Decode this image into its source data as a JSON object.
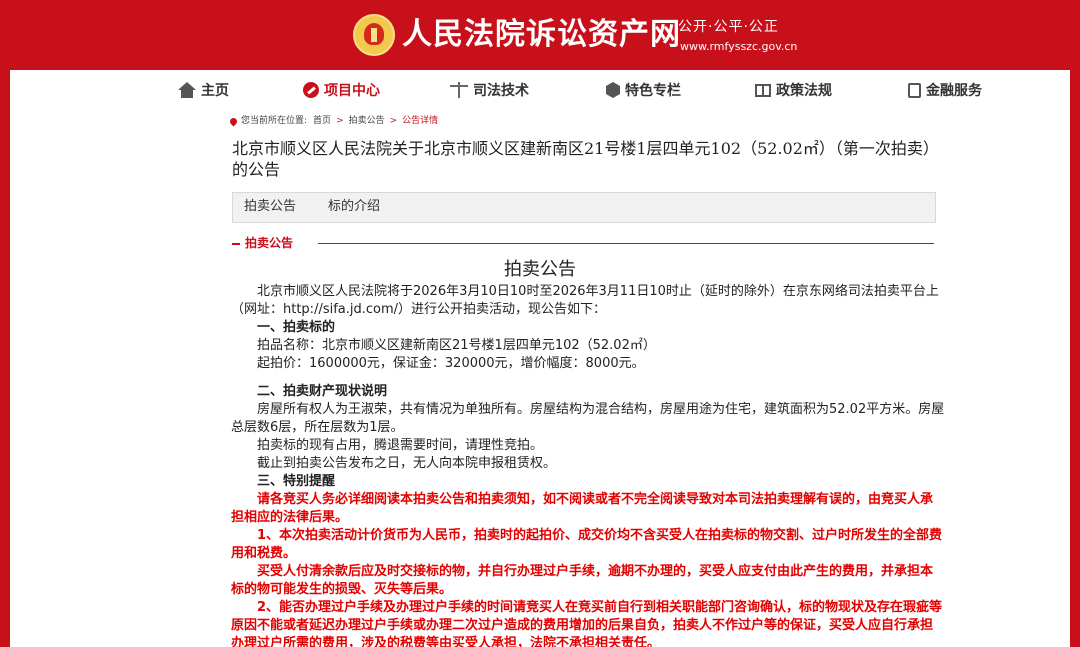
{
  "header": {
    "site_title": "人民法院诉讼资产网",
    "slogan": "公开·公平·公正",
    "url": "www.rmfyssz c.gov.cn",
    "brand_color": "#c8101b"
  },
  "nav": {
    "items": [
      {
        "label": "主页",
        "icon": "home-icon"
      },
      {
        "label": "项目中心",
        "icon": "gavel-icon",
        "active": true
      },
      {
        "label": "司法技术",
        "icon": "scale-icon"
      },
      {
        "label": "特色专栏",
        "icon": "feature-icon"
      },
      {
        "label": "政策法规",
        "icon": "book-icon"
      },
      {
        "label": "金融服务",
        "icon": "finance-icon"
      }
    ]
  },
  "breadcrumb": {
    "prefix": "您当前所在位置:",
    "items": [
      "首页",
      "拍卖公告",
      "公告详情"
    ],
    "sep": ">"
  },
  "page_title": "北京市顺义区人民法院关于北京市顺义区建新南区21号楼1层四单元102（52.02㎡）（第一次拍卖）的公告",
  "tabs": [
    "拍卖公告",
    "标的介绍"
  ],
  "section_label": "拍卖公告",
  "notice": {
    "title": "拍卖公告",
    "intro": "北京市顺义区人民法院将于2026年3月10日10时至2026年3月11日10时止（延时的除外）在京东网络司法拍卖平台上（网址：http://sifa.jd.com/）进行公开拍卖活动，现公告如下：",
    "h1": "一、拍卖标的",
    "item_name": "拍品名称：北京市顺义区建新南区21号楼1层四单元102（52.02㎡）",
    "prices": "起拍价：1600000元，保证金：320000元，增价幅度：8000元。",
    "h2": "二、拍卖财产现状说明",
    "status1": "房屋所有权人为王淑荣，共有情况为单独所有。房屋结构为混合结构，房屋用途为住宅，建筑面积为52.02平方米。房屋总层数6层，所在层数为1层。",
    "status2": "拍卖标的现有占用，腾退需要时间，请理性竞拍。",
    "status3": "截止到拍卖公告发布之日，无人向本院申报租赁权。",
    "h3": "三、特别提醒",
    "red1": "请各竞买人务必详细阅读本拍卖公告和拍卖须知，如不阅读或者不完全阅读导致对本司法拍卖理解有误的，由竞买人承担相应的法律后果。",
    "red2": "1、本次拍卖活动计价货币为人民币，拍卖时的起拍价、成交价均不含买受人在拍卖标的物交割、过户时所发生的全部费用和税费。",
    "red3": "买受人付清余款后应及时交接标的物，并自行办理过户手续，逾期不办理的，买受人应支付由此产生的费用，并承担本标的物可能发生的损毁、灭失等后果。",
    "red4": "2、能否办理过户手续及办理过户手续的时间请竞买人在竞买前自行到相关职能部门咨询确认，标的物现状及存在瑕疵等原因不能或者延迟办理过户手续或办理二次过户造成的费用增加的后果自负，拍卖人不作过户等的保证，买受人应自行承担办理过户所需的费用，涉及的税费等由买受人承担，法院不承担相关责任。"
  }
}
